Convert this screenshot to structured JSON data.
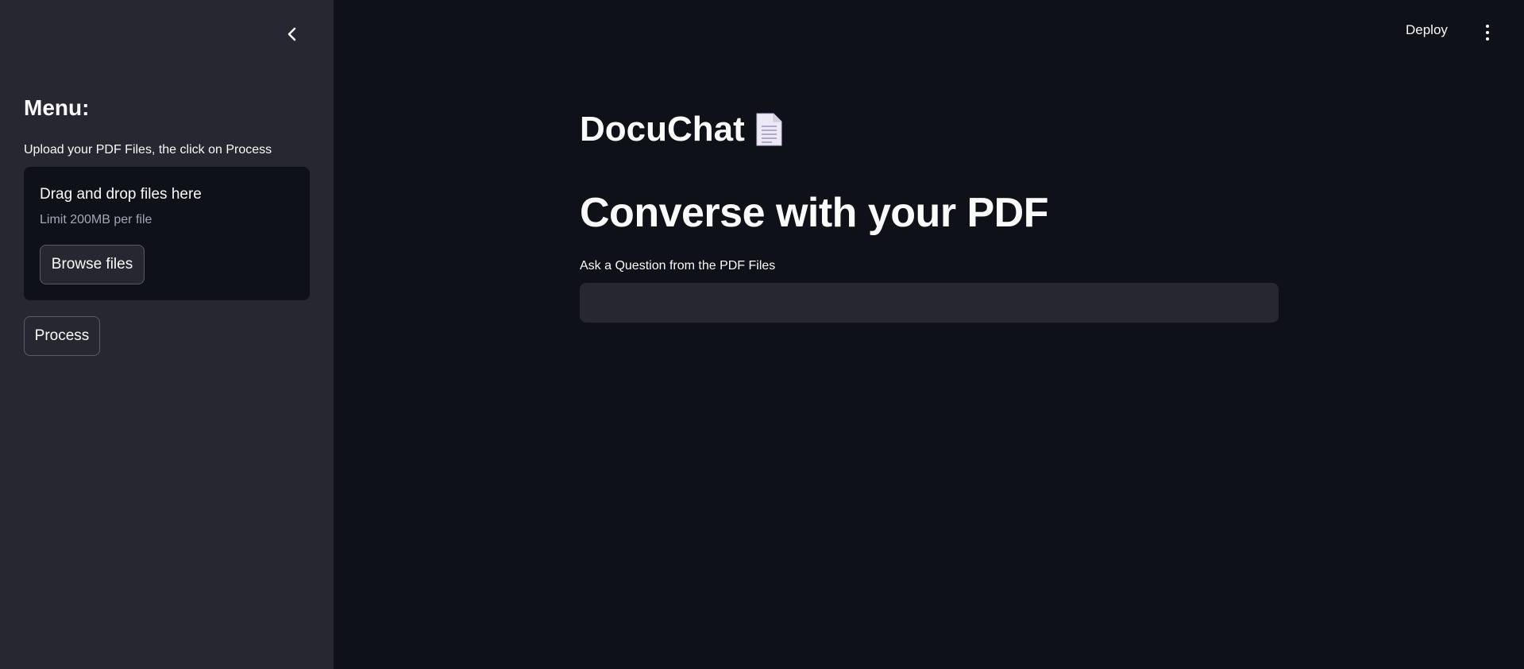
{
  "sidebar": {
    "collapse_icon": "chevron-left-icon",
    "heading": "Menu:",
    "upload_label": "Upload your PDF Files, the click on Process",
    "dropzone": {
      "title": "Drag and drop files here",
      "subtitle": "Limit 200MB per file",
      "browse_label": "Browse files"
    },
    "process_label": "Process"
  },
  "header": {
    "deploy_label": "Deploy",
    "menu_icon": "kebab-menu-icon"
  },
  "main": {
    "app_title": "DocuChat",
    "title_icon": "document-icon",
    "heading": "Converse with your PDF",
    "question_label": "Ask a Question from the PDF Files",
    "question_value": ""
  },
  "colors": {
    "main_bg": "#0e1117",
    "sidebar_bg": "#262730",
    "text": "#fafafa",
    "muted_text": "#a3a8b8"
  }
}
